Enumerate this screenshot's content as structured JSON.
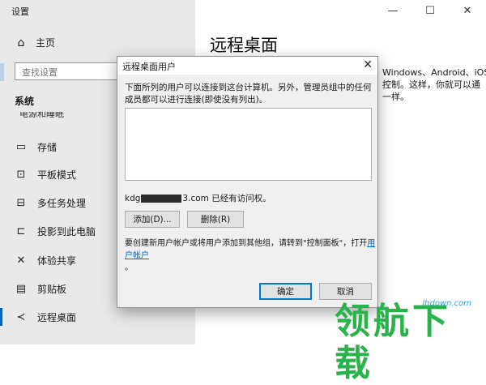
{
  "window": {
    "title": "设置",
    "controls": [
      "—",
      "☐",
      "✕"
    ]
  },
  "sidebar": {
    "home": {
      "icon": "home-icon",
      "label": "主页"
    },
    "search": {
      "placeholder": "查找设置"
    },
    "section": "系统",
    "cut_label": "电源和睡眠",
    "items": [
      {
        "icon": "storage-icon",
        "glyph": "▭",
        "label": "存储"
      },
      {
        "icon": "tablet-mode-icon",
        "glyph": "⊡",
        "label": "平板模式"
      },
      {
        "icon": "multitasking-icon",
        "glyph": "⊟",
        "label": "多任务处理"
      },
      {
        "icon": "project-icon",
        "glyph": "⊏",
        "label": "投影到此电脑"
      },
      {
        "icon": "shared-experiences-icon",
        "glyph": "✕",
        "label": "体验共享"
      },
      {
        "icon": "clipboard-icon",
        "glyph": "▤",
        "label": "剪贴板"
      },
      {
        "icon": "remote-desktop-icon",
        "glyph": "≺",
        "label": "远程桌面"
      }
    ]
  },
  "main": {
    "title": "远程桌面",
    "desc_line1": "Windows、Android、iOS",
    "desc_line2": "控制。这样，你就可以通",
    "desc_line3": "一样。"
  },
  "dialog": {
    "title": "远程桌面用户",
    "intro": "下面所列的用户可以连接到这台计算机。另外，管理员组中的任何成员都可以进行连接(即使没有列出)。",
    "user_prefix": "kdg",
    "user_suffix": "3.com 已经有访问权。",
    "add_label": "添加(D)...",
    "remove_label": "删除(R)",
    "note_text": "要创建新用户帐户或将用户添加到其他组，请转到\"控制面板\"，打开",
    "note_link": "用户帐户",
    "note_end": "。",
    "ok_label": "确定",
    "cancel_label": "取消"
  },
  "watermark": {
    "domain": "lhdown.com",
    "logo": "领航下载"
  }
}
